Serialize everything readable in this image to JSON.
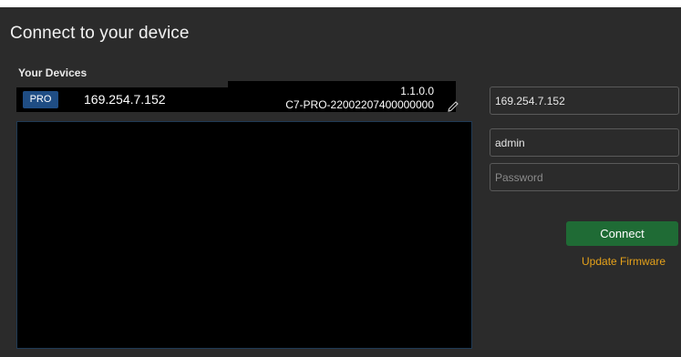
{
  "header": {
    "title": "Connect to your device"
  },
  "devices": {
    "section_label": "Your Devices",
    "selected": {
      "badge": "PRO",
      "ip": "169.254.7.152",
      "version": "1.1.0.0",
      "serial": "C7-PRO-22002207400000000"
    },
    "edit_icon": "pencil-icon"
  },
  "login": {
    "ip_value": "169.254.7.152",
    "username_value": "admin",
    "password_placeholder": "Password",
    "connect_label": "Connect",
    "update_label": "Update Firmware"
  },
  "colors": {
    "background": "#2b2b2b",
    "connect_button": "#1f6b35",
    "update_link": "#e6a21a",
    "badge": "#1f4d84"
  }
}
